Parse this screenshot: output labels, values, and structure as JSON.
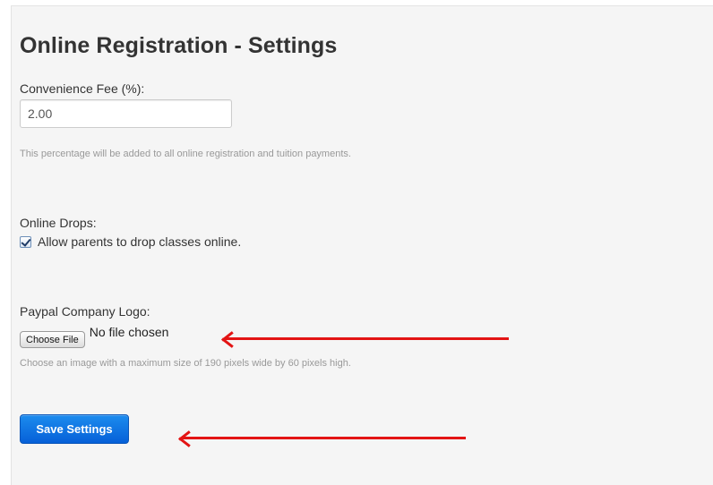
{
  "page": {
    "title": "Online Registration - Settings"
  },
  "convenience_fee": {
    "label": "Convenience Fee (%):",
    "value": "2.00",
    "help": "This percentage will be added to all online registration and tuition payments."
  },
  "online_drops": {
    "label": "Online Drops:",
    "checkbox_label": "Allow parents to drop classes online.",
    "checked": true
  },
  "paypal_logo": {
    "label": "Paypal Company Logo:",
    "button_label": "Choose File",
    "file_status": "No file chosen",
    "help": "Choose an image with a maximum size of 190 pixels wide by 60 pixels high."
  },
  "actions": {
    "save_label": "Save Settings"
  },
  "colors": {
    "primary_button": "#0660d8",
    "annotation_arrow": "#e31414",
    "panel_background": "#f5f5f5"
  }
}
